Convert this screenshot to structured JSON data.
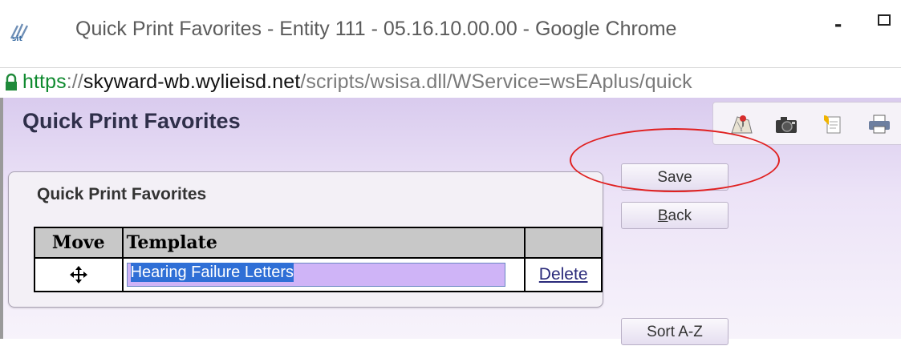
{
  "window": {
    "title": "Quick Print Favorites - Entity 111 - 05.16.10.00.00 - Google Chrome",
    "minimize_glyph": "-",
    "app_icon": "skyward-logo-icon"
  },
  "address_bar": {
    "scheme": "https",
    "separator": "://",
    "host": "skyward-wb.wylieisd.net",
    "path": "/scripts/wsisa.dll/WService=wsEAplus/quick"
  },
  "page": {
    "title": "Quick Print Favorites",
    "toolbar_icons": [
      "map-pin-icon",
      "camera-icon",
      "notes-icon",
      "print-icon"
    ]
  },
  "panel": {
    "title": "Quick Print Favorites",
    "table": {
      "columns": [
        "Move",
        "Template",
        ""
      ],
      "rows": [
        {
          "move_icon": "move-arrows-icon",
          "template": "Hearing Failure Letters",
          "action": "Delete"
        }
      ]
    }
  },
  "buttons": {
    "save": "Save",
    "back_underlined": "B",
    "back_rest": "ack",
    "sort": "Sort A-Z"
  },
  "annotation": {
    "color": "#e02020"
  },
  "colors": {
    "page_gradient_top": "#d9cbee",
    "selection": "#2f6fd6",
    "input_fill": "#cfb4f7"
  }
}
